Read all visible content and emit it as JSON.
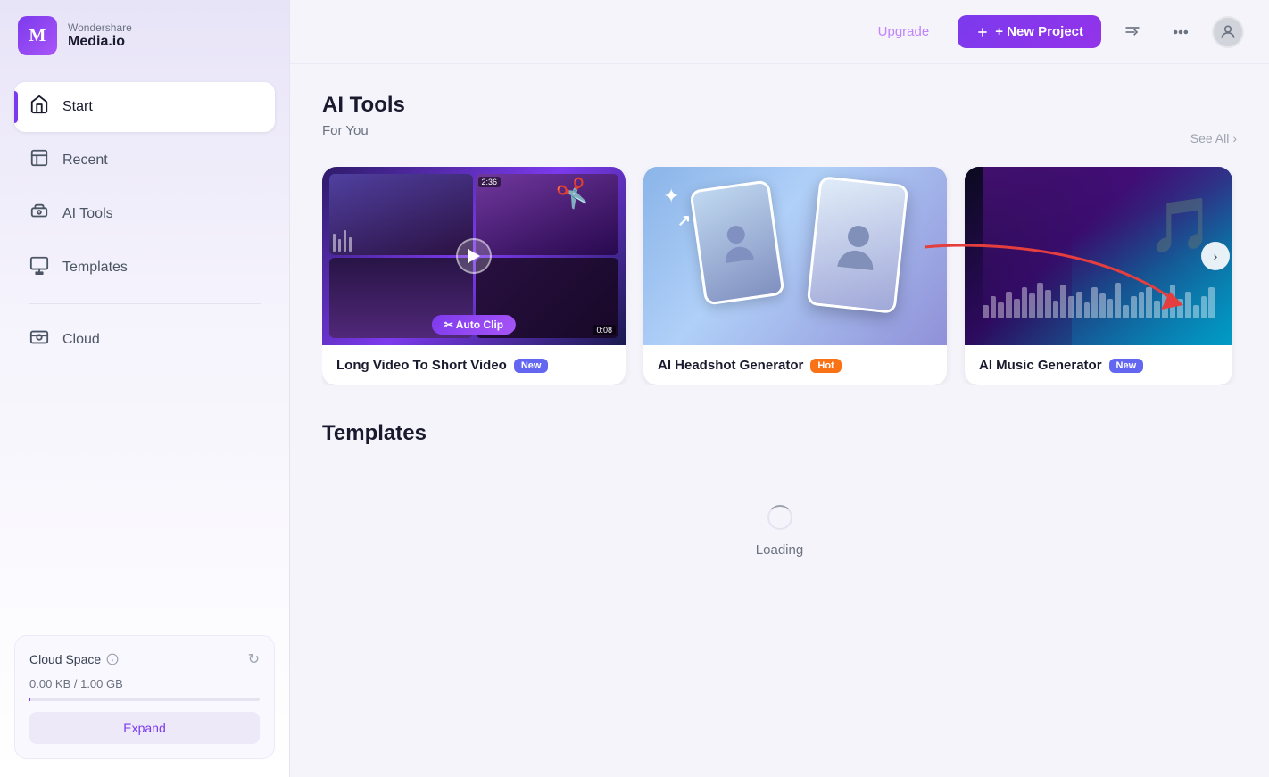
{
  "app": {
    "brand_top": "Wondershare",
    "brand_name": "Media.io",
    "logo_letter": "m"
  },
  "sidebar": {
    "items": [
      {
        "id": "start",
        "label": "Start",
        "icon": "🏠",
        "active": true
      },
      {
        "id": "recent",
        "label": "Recent",
        "icon": "📋",
        "active": false
      },
      {
        "id": "ai-tools",
        "label": "AI Tools",
        "icon": "🤖",
        "active": false
      },
      {
        "id": "templates",
        "label": "Templates",
        "icon": "⬛",
        "active": false
      },
      {
        "id": "cloud",
        "label": "Cloud",
        "icon": "📦",
        "active": false
      }
    ]
  },
  "cloud_space": {
    "title": "Cloud Space",
    "usage": "0.00 KB / 1.00 GB",
    "expand_label": "Expand",
    "percent": 0.1
  },
  "topbar": {
    "upgrade_label": "Upgrade",
    "new_project_label": "+ New Project"
  },
  "ai_tools_section": {
    "title": "AI Tools",
    "subtitle": "For You",
    "see_all_label": "See All",
    "tools": [
      {
        "id": "long-to-short",
        "label": "Long Video To Short Video",
        "badge": "New",
        "badge_type": "new",
        "timestamp_top": "2:36",
        "timestamp_bottom": "0:08",
        "autoclip_label": "✂ Auto Clip"
      },
      {
        "id": "headshot-generator",
        "label": "AI Headshot Generator",
        "badge": "Hot",
        "badge_type": "hot"
      },
      {
        "id": "music-generator",
        "label": "AI Music Generator",
        "badge": "New",
        "badge_type": "new"
      }
    ]
  },
  "templates_section": {
    "title": "Templates",
    "loading_text": "Loading"
  },
  "waveform_heights": [
    15,
    25,
    18,
    30,
    22,
    35,
    28,
    40,
    32,
    20,
    38,
    25,
    30,
    18,
    35,
    28,
    22,
    40,
    15,
    25,
    30,
    35,
    20,
    28,
    38,
    22,
    30,
    15,
    25,
    35
  ]
}
